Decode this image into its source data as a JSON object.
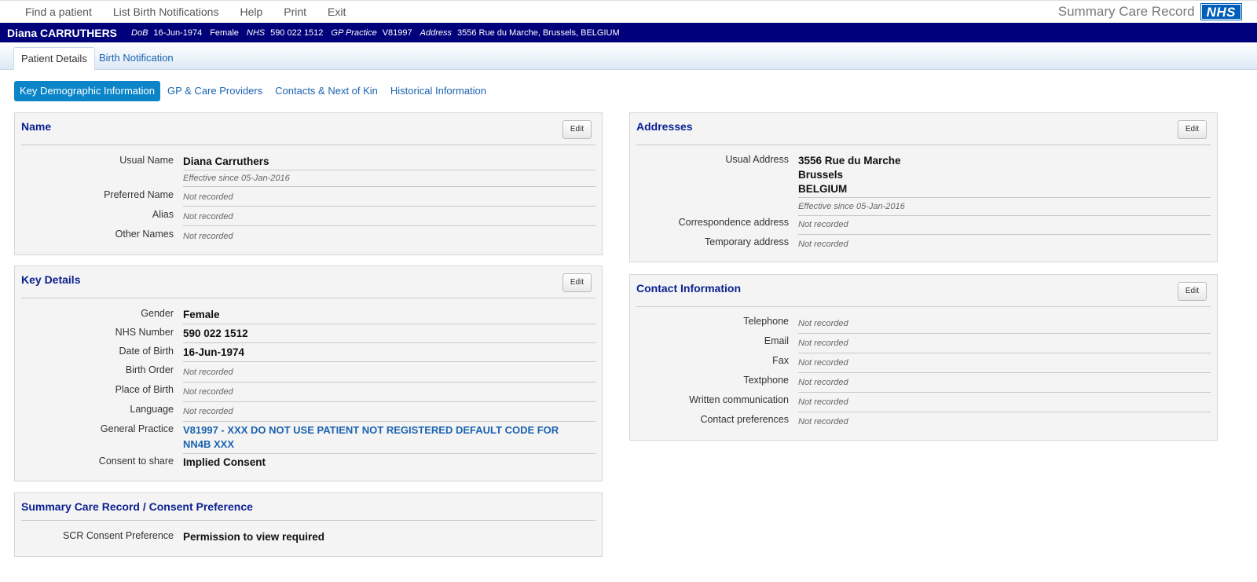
{
  "topmenu": {
    "items": [
      "Find a patient",
      "List Birth Notifications",
      "Help",
      "Print",
      "Exit"
    ],
    "brand": "Summary Care Record",
    "logo": "NHS"
  },
  "banner": {
    "name": "Diana CARRUTHERS",
    "dob_label": "DoB",
    "dob": "16-Jun-1974",
    "gender": "Female",
    "nhs_label": "NHS",
    "nhs": "590 022 1512",
    "gp_label": "GP Practice",
    "gp": "V81997",
    "address_label": "Address",
    "address": "3556 Rue du Marche, Brussels, BELGIUM"
  },
  "tabs": [
    "Patient Details",
    "Birth Notification"
  ],
  "subnav": [
    "Key Demographic Information",
    "GP & Care Providers",
    "Contacts & Next of Kin",
    "Historical Information"
  ],
  "edit_label": "Edit",
  "name_panel": {
    "title": "Name",
    "usual_label": "Usual Name",
    "usual_value": "Diana Carruthers",
    "usual_effective": "Effective since 05-Jan-2016",
    "preferred_label": "Preferred Name",
    "preferred_value": "Not recorded",
    "alias_label": "Alias",
    "alias_value": "Not recorded",
    "other_label": "Other Names",
    "other_value": "Not recorded"
  },
  "key_details": {
    "title": "Key Details",
    "gender_label": "Gender",
    "gender_value": "Female",
    "nhs_label": "NHS Number",
    "nhs_value": "590 022 1512",
    "dob_label": "Date of Birth",
    "dob_value": "16-Jun-1974",
    "birth_order_label": "Birth Order",
    "birth_order_value": "Not recorded",
    "pob_label": "Place of Birth",
    "pob_value": "Not recorded",
    "language_label": "Language",
    "language_value": "Not recorded",
    "gp_label": "General Practice",
    "gp_value": "V81997 - XXX DO NOT USE PATIENT NOT REGISTERED DEFAULT CODE FOR NN4B XXX",
    "consent_label": "Consent to share",
    "consent_value": "Implied Consent"
  },
  "scr_panel": {
    "title": "Summary Care Record / Consent Preference",
    "pref_label": "SCR Consent Preference",
    "pref_value": "Permission to view required"
  },
  "addresses": {
    "title": "Addresses",
    "usual_label": "Usual Address",
    "line1": "3556 Rue du Marche",
    "line2": "Brussels",
    "line3": "BELGIUM",
    "effective": "Effective since 05-Jan-2016",
    "corr_label": "Correspondence address",
    "corr_value": "Not recorded",
    "temp_label": "Temporary address",
    "temp_value": "Not recorded"
  },
  "contact": {
    "title": "Contact Information",
    "telephone_label": "Telephone",
    "telephone_value": "Not recorded",
    "email_label": "Email",
    "email_value": "Not recorded",
    "fax_label": "Fax",
    "fax_value": "Not recorded",
    "textphone_label": "Textphone",
    "textphone_value": "Not recorded",
    "written_label": "Written communication",
    "written_value": "Not recorded",
    "prefs_label": "Contact preferences",
    "prefs_value": "Not recorded"
  },
  "colors": {
    "banner": "#00007a",
    "link": "#1a63b0",
    "active_pill": "#0b85c8",
    "panel_title": "#0a1f8f",
    "nhs_blue": "#005eb8"
  }
}
